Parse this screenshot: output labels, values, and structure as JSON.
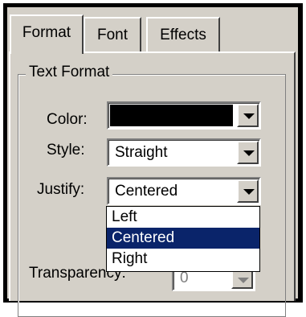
{
  "tabs": [
    {
      "label": "Format",
      "selected": true
    },
    {
      "label": "Font",
      "selected": false
    },
    {
      "label": "Effects",
      "selected": false
    }
  ],
  "group": {
    "title": "Text Format"
  },
  "fields": {
    "color": {
      "label": "Color:",
      "value_color": "#000000"
    },
    "style": {
      "label": "Style:",
      "value": "Straight"
    },
    "justify": {
      "label": "Justify:",
      "value": "Centered"
    },
    "transparency": {
      "label": "Transparency:",
      "value": "0"
    }
  },
  "justify_options": [
    "Left",
    "Centered",
    "Right"
  ],
  "selected_option": "Centered",
  "colors": {
    "face": "#d4d0c8",
    "highlight": "#0a246a"
  }
}
